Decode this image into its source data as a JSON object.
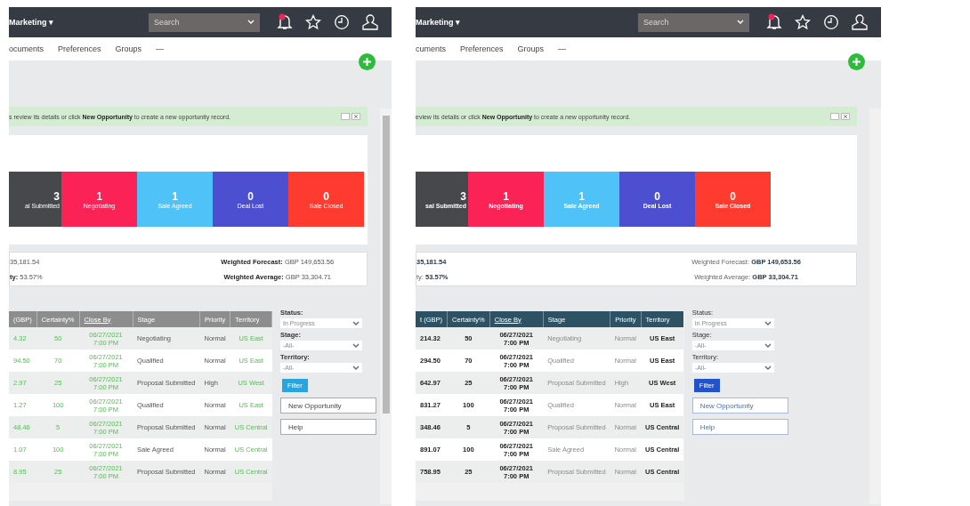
{
  "panels": [
    {
      "kind": "classic",
      "topbar": {
        "menu": "Marketing ▾",
        "search": {
          "placeholder": "Search"
        }
      },
      "nav": [
        "ocuments",
        "Preferences",
        "Groups",
        "—"
      ],
      "message": "s review its details or click **New Opportunity** to create a new opportunity record.",
      "funnel": [
        {
          "count": "3",
          "label": "al Submitted",
          "color": "#46484c"
        },
        {
          "count": "1",
          "label": "Negotiating",
          "color": "#fb2355"
        },
        {
          "count": "1",
          "label": "Sale Agreed",
          "color": "#4fc3f7"
        },
        {
          "count": "0",
          "label": "Deal Lost",
          "color": "#4c4fd0"
        },
        {
          "count": "0",
          "label": "Sale Closed",
          "color": "#ff3b2f"
        }
      ],
      "summary": [
        {
          "value": "35,181.54"
        },
        {
          "label": "Weighted Forecast:",
          "value": "GBP 149,653.56"
        },
        {
          "label": "ty:",
          "value": "53.57%"
        },
        {
          "label": "Weighted Average:",
          "value": "GBP 33,304.71"
        }
      ],
      "table": {
        "columns": [
          "(GBP)",
          "Certainty%",
          "Close By",
          "Stage",
          "Priority",
          "Territory"
        ],
        "rows": [
          [
            "4.32",
            "50",
            "06/27/2021 7:00 PM",
            "Negotiating",
            "Normal",
            "US East"
          ],
          [
            "94.50",
            "70",
            "06/27/2021 7:00 PM",
            "Qualified",
            "Normal",
            "US East"
          ],
          [
            "2.97",
            "25",
            "06/27/2021 7:00 PM",
            "Proposal Submitted",
            "High",
            "US West"
          ],
          [
            "1.27",
            "100",
            "06/27/2021 7:00 PM",
            "Qualified",
            "Normal",
            "US East"
          ],
          [
            "48.46",
            "5",
            "06/27/2021 7:00 PM",
            "Proposal Submitted",
            "Normal",
            "US Central"
          ],
          [
            "1.07",
            "100",
            "06/27/2021 7:00 PM",
            "Sale Agreed",
            "Normal",
            "US Central"
          ],
          [
            "8.95",
            "25",
            "06/27/2021 7:00 PM",
            "Proposal Submitted",
            "Normal",
            "US Central"
          ]
        ]
      },
      "filters": [
        {
          "label": "Status:",
          "value": "In Progress"
        },
        {
          "label": "Stage:",
          "value": "-All-"
        },
        {
          "label": "Territory:",
          "value": "-All-"
        }
      ],
      "filter_button": "Filter",
      "actions": [
        "New Opportunity",
        "Help"
      ]
    },
    {
      "kind": "modern",
      "topbar": {
        "menu": "Marketing ▾",
        "search": {
          "placeholder": "Search"
        }
      },
      "nav": [
        "cuments",
        "Preferences",
        "Groups",
        "—"
      ],
      "message": "eview its details or click **New Opportunity** to create a new opportunity record.",
      "funnel": [
        {
          "count": "3",
          "label": "sal Submitted",
          "color": "#46484c"
        },
        {
          "count": "1",
          "label": "Negotiating",
          "color": "#fb2355"
        },
        {
          "count": "1",
          "label": "Sale Agreed",
          "color": "#4fc3f7"
        },
        {
          "count": "0",
          "label": "Deal Lost",
          "color": "#4c4fd0"
        },
        {
          "count": "0",
          "label": "Sale Closed",
          "color": "#ff3b2f"
        }
      ],
      "summary": [
        {
          "value": "35,181.54"
        },
        {
          "label": "Weighted Forecast:",
          "value": "GBP 149,653.56"
        },
        {
          "label": "ty:",
          "value": "53.57%"
        },
        {
          "label": "Weighted Average:",
          "value": "GBP 33,304.71"
        }
      ],
      "table": {
        "columns": [
          "t (GBP)",
          "Certainty%",
          "Close By",
          "Stage",
          "Priority",
          "Territory"
        ],
        "rows": [
          [
            "214.32",
            "50",
            "06/27/2021 7:00 PM",
            "Negotiating",
            "Normal",
            "US East"
          ],
          [
            "294.50",
            "70",
            "06/27/2021 7:00 PM",
            "Qualified",
            "Normal",
            "US East"
          ],
          [
            "642.97",
            "25",
            "06/27/2021 7:00 PM",
            "Proposal Submitted",
            "High",
            "US West"
          ],
          [
            "831.27",
            "100",
            "06/27/2021 7:00 PM",
            "Qualified",
            "Normal",
            "US East"
          ],
          [
            "348.46",
            "5",
            "06/27/2021 7:00 PM",
            "Proposal Submitted",
            "Normal",
            "US Central"
          ],
          [
            "891.07",
            "100",
            "06/27/2021 7:00 PM",
            "Sale Agreed",
            "Normal",
            "US Central"
          ],
          [
            "758.95",
            "25",
            "06/27/2021 7:00 PM",
            "Proposal Submitted",
            "Normal",
            "US Central"
          ]
        ]
      },
      "filters": [
        {
          "label": "Status:",
          "value": "In Progress"
        },
        {
          "label": "Stage:",
          "value": "-All-"
        },
        {
          "label": "Territory:",
          "value": "-All-"
        }
      ],
      "filter_button": "Filter",
      "actions": [
        "New Opportunity",
        "Help"
      ]
    }
  ]
}
